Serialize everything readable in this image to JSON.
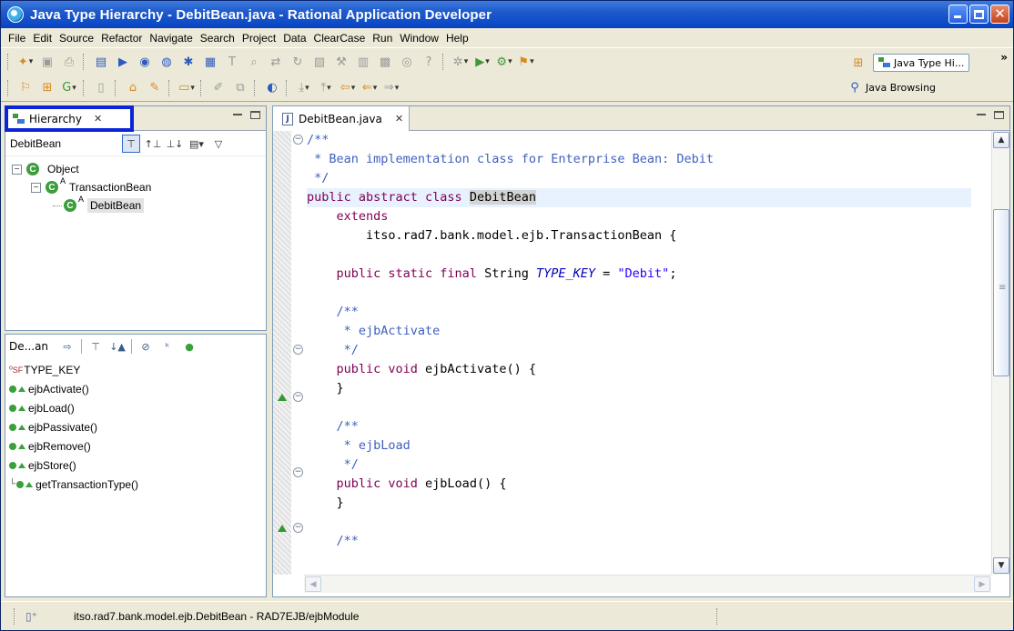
{
  "window": {
    "title": "Java Type Hierarchy - DebitBean.java - Rational Application Developer"
  },
  "menu": [
    "File",
    "Edit",
    "Source",
    "Refactor",
    "Navigate",
    "Search",
    "Project",
    "Data",
    "ClearCase",
    "Run",
    "Window",
    "Help"
  ],
  "perspectives": {
    "current": "Java Type Hi...",
    "other": "Java Browsing",
    "more": "»"
  },
  "hierarchy_view": {
    "tab_label": "Hierarchy",
    "tab_close": "✕",
    "type_label": "DebitBean",
    "tree": [
      {
        "label": "Object",
        "icon": "C",
        "sup": ""
      },
      {
        "label": "TransactionBean",
        "icon": "C",
        "sup": "A"
      },
      {
        "label": "DebitBean",
        "icon": "C",
        "sup": "A"
      }
    ]
  },
  "members_view": {
    "type_label": "De...an",
    "members": [
      {
        "label": "TYPE_KEY",
        "kind": "field",
        "modifiers": "SF"
      },
      {
        "label": "ejbActivate()",
        "kind": "method"
      },
      {
        "label": "ejbLoad()",
        "kind": "method"
      },
      {
        "label": "ejbPassivate()",
        "kind": "method"
      },
      {
        "label": "ejbRemove()",
        "kind": "method"
      },
      {
        "label": "ejbStore()",
        "kind": "method"
      },
      {
        "label": "getTransactionType()",
        "kind": "method-inherited"
      }
    ]
  },
  "editor": {
    "tab_label": "DebitBean.java",
    "tab_close": "✕",
    "code": {
      "l1": "/**",
      "l2": " * Bean implementation class for Enterprise Bean: Debit",
      "l3": " */",
      "l4_kw": "public abstract class ",
      "l4_name": "DebitBean",
      "l5": "    extends",
      "l6": "        itso.rad7.bank.model.ejb.TransactionBean {",
      "l8_kw": "    public static final ",
      "l8_type": "String ",
      "l8_field": "TYPE_KEY",
      "l8_eq": " = ",
      "l8_str": "\"Debit\"",
      "l8_end": ";",
      "l10": "    /**",
      "l11": "     * ejbActivate",
      "l12": "     */",
      "l13_kw": "    public void ",
      "l13_rest": "ejbActivate() {",
      "l14": "    }",
      "l16": "    /**",
      "l17": "     * ejbLoad",
      "l18": "     */",
      "l19_kw": "    public void ",
      "l19_rest": "ejbLoad() {",
      "l20": "    }",
      "l22": "    /**"
    }
  },
  "status": {
    "text": "itso.rad7.bank.model.ejb.DebitBean - RAD7EJB/ejbModule"
  }
}
